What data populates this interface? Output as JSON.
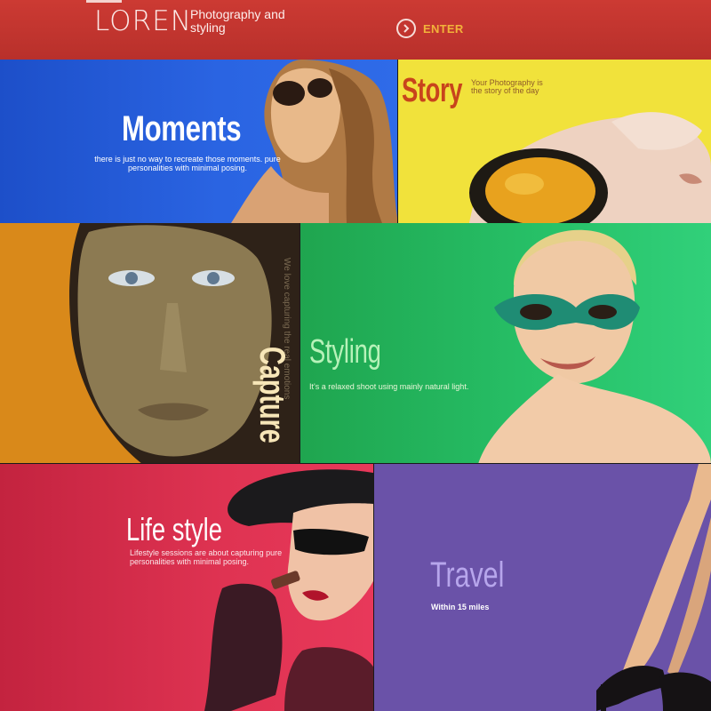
{
  "header": {
    "logo": "LOREN",
    "tagline": "Photography and styling",
    "enter_label": "ENTER",
    "background": "#c1342e",
    "enter_color": "#f2b23a"
  },
  "tiles": {
    "moments": {
      "title": "Moments",
      "text": "there is just no way to recreate those moments. pure personalities with minimal posing.",
      "color": "#2a64e2"
    },
    "story": {
      "title": "Story",
      "text": "Your Photography is the story of the day",
      "color": "#f1e23b"
    },
    "capture": {
      "title": "Capture",
      "text": "We love capturing the real emotions",
      "color": "#d9891a"
    },
    "styling": {
      "title": "Styling",
      "text": "It's a relaxed shoot using mainly natural light.",
      "color": "#27c168"
    },
    "life_style": {
      "title": "Life style",
      "text": "Lifestyle sessions are about capturing pure personalities with minimal posing.",
      "color": "#df3352"
    },
    "travel": {
      "title": "Travel",
      "text": "Within 15 miles",
      "color": "#6a52a8"
    }
  }
}
